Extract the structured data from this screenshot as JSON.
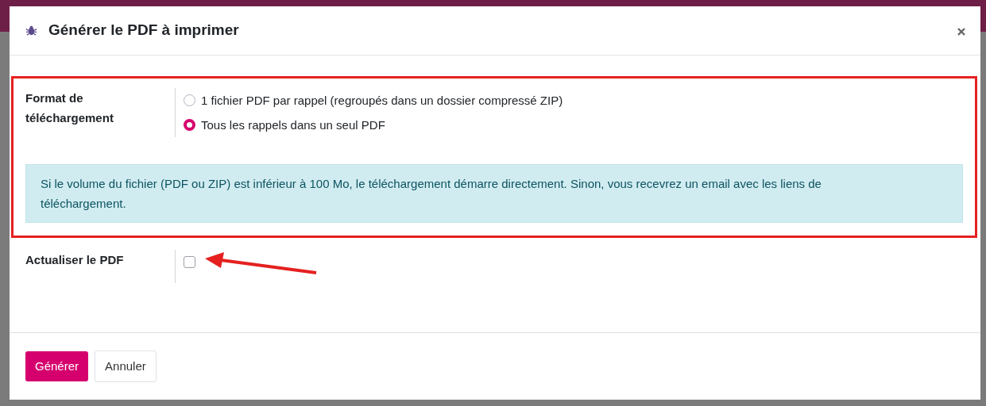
{
  "dialog": {
    "title": "Générer le PDF à imprimer",
    "sections": [
      {
        "kind": "radio",
        "label": "Format de téléchargement",
        "highlighted": true,
        "options": [
          {
            "label": "1 fichier PDF par rappel (regroupés dans un dossier compressé ZIP)",
            "selected": false
          },
          {
            "label": "Tous les rappels dans un seul PDF",
            "selected": true
          }
        ]
      },
      {
        "kind": "alert",
        "text": "Si le volume du fichier (PDF ou ZIP) est inférieur à 100 Mo, le téléchargement démarre directement. Sinon, vous recevrez un email avec les liens de téléchargement.",
        "highlighted": true
      },
      {
        "kind": "checkbox",
        "label": "Actualiser le PDF",
        "checked": false,
        "pointed": true
      }
    ],
    "buttons": [
      {
        "label": "Générer",
        "kind": "primary"
      },
      {
        "label": "Annuler",
        "kind": "secondary"
      }
    ]
  }
}
